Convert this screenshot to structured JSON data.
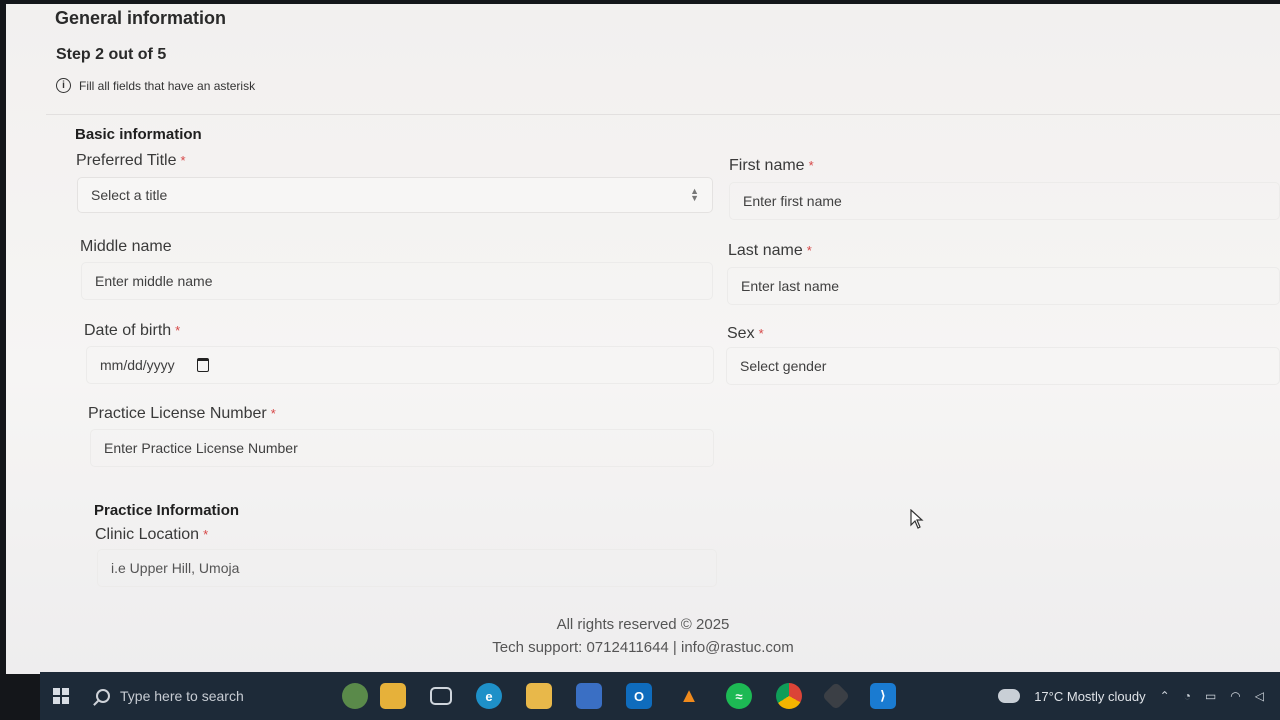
{
  "page": {
    "title": "General information",
    "step": "Step 2 out of 5",
    "hint": "Fill all fields that have an asterisk",
    "info_icon": "info-icon"
  },
  "basic": {
    "heading": "Basic information",
    "preferred_title": {
      "label": "Preferred Title",
      "value": "Select a title"
    },
    "first_name": {
      "label": "First name",
      "placeholder": "Enter first name"
    },
    "middle_name": {
      "label": "Middle name",
      "placeholder": "Enter middle name"
    },
    "last_name": {
      "label": "Last name",
      "placeholder": "Enter last name"
    },
    "dob": {
      "label": "Date of birth",
      "placeholder": "mm/dd/yyyy"
    },
    "sex": {
      "label": "Sex",
      "value": "Select gender"
    },
    "license": {
      "label": "Practice License Number",
      "placeholder": "Enter Practice License Number"
    }
  },
  "practice": {
    "heading": "Practice Information",
    "clinic_location": {
      "label": "Clinic Location",
      "placeholder": "i.e Upper Hill, Umoja"
    }
  },
  "required_mark": "*",
  "footer": {
    "rights": "All rights reserved © 2025",
    "support": "Tech support: 0712411644 | info@rastuc.com"
  },
  "taskbar": {
    "search_placeholder": "Type here to search",
    "apps": [
      "task-view-icon",
      "edge-icon",
      "file-explorer-icon",
      "store-icon",
      "outlook-icon",
      "vlc-icon",
      "spotify-icon",
      "chrome-icon",
      "git-icon",
      "vscode-icon"
    ],
    "weather_temp": "17°C",
    "weather_text": "Mostly cloudy"
  },
  "colors": {
    "required": "#d64545",
    "taskbar": "#1d2a38"
  }
}
